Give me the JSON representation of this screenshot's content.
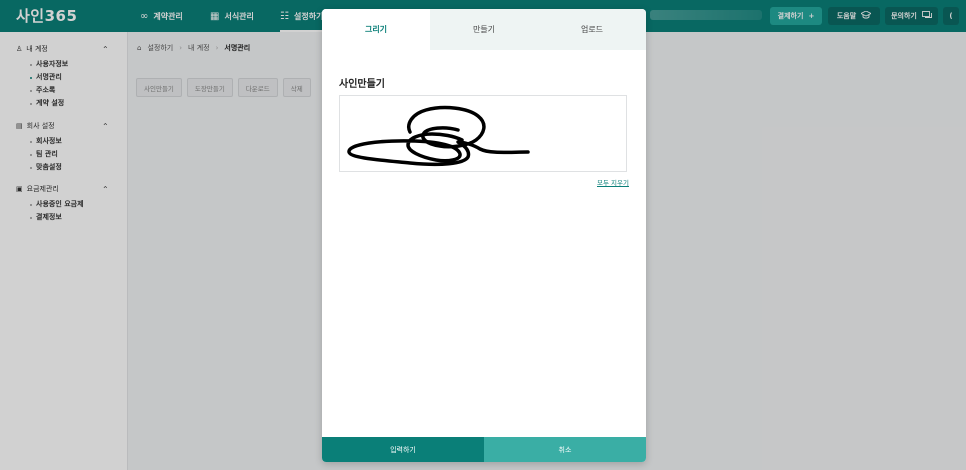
{
  "app": {
    "logo": "사인365"
  },
  "topnav": {
    "items": [
      {
        "icon": "∞",
        "label": "계약관리"
      },
      {
        "icon": "▦",
        "label": "서식관리"
      },
      {
        "icon": "☷",
        "label": "설정하기"
      }
    ]
  },
  "header_buttons": {
    "pay": {
      "label": "결제하기",
      "icon": "+"
    },
    "help": {
      "label": "도움말",
      "icon": "🎓"
    },
    "inquiry": {
      "label": "문의하기",
      "icon": "⌨"
    },
    "more": {
      "label": "("
    }
  },
  "sidebar": {
    "sections": [
      {
        "icon": "♙",
        "title": "내 계정",
        "chevron": "⌃",
        "items": [
          "사용자정보",
          "서명관리",
          "주소록",
          "계약 설정"
        ]
      },
      {
        "icon": "▤",
        "title": "회사 설정",
        "chevron": "⌃",
        "items": [
          "회사정보",
          "팀 관리",
          "맞춤설정"
        ]
      },
      {
        "icon": "▣",
        "title": "요금제관리",
        "chevron": "⌃",
        "items": [
          "사용중인 요금제",
          "결제정보"
        ]
      }
    ]
  },
  "breadcrumb": {
    "home_icon": "⌂",
    "items": [
      "설정하기",
      "내 계정",
      "서명관리"
    ],
    "sep": "›"
  },
  "actions": [
    "사인만들기",
    "도장만들기",
    "다운로드",
    "삭제"
  ],
  "modal": {
    "tabs": [
      "그리기",
      "만들기",
      "업로드"
    ],
    "active_tab": "그리기",
    "title": "사인만들기",
    "clear_link": "모두 지우기",
    "submit_label": "입력하기",
    "cancel_label": "취소"
  },
  "colors": {
    "brand": "#0a7f78",
    "accent": "#3aaea5"
  }
}
